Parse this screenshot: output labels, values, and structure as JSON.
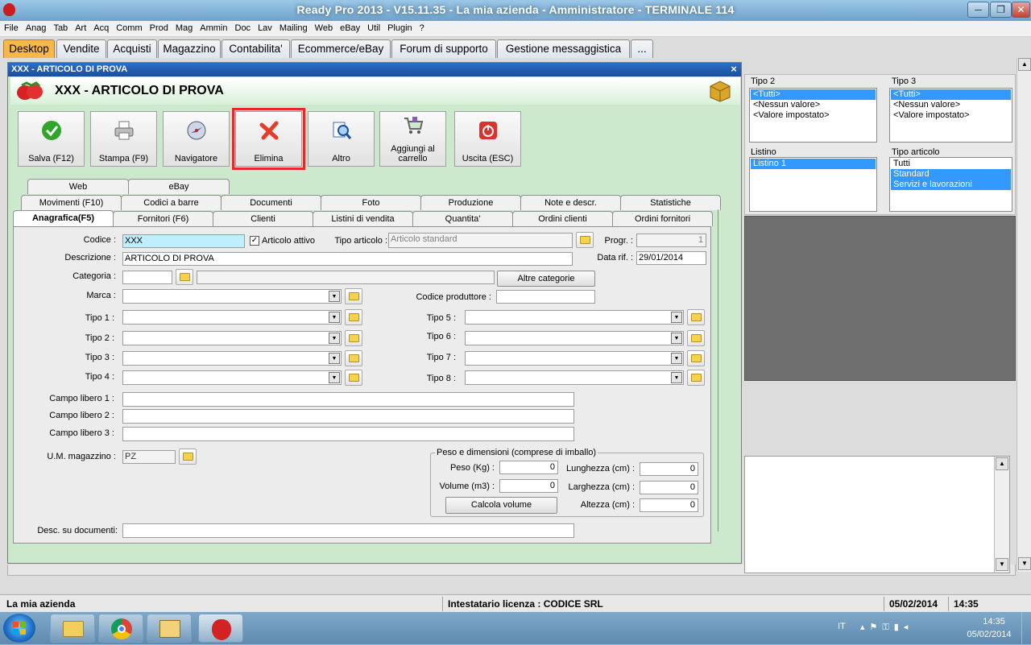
{
  "window": {
    "title": "Ready Pro 2013 - V15.11.35 - La mia azienda - Amministratore - TERMINALE 114",
    "min": "─",
    "restore": "❐",
    "close": "✕"
  },
  "menu": [
    "File",
    "Anag",
    "Tab",
    "Art",
    "Acq",
    "Comm",
    "Prod",
    "Mag",
    "Ammin",
    "Doc",
    "Lav",
    "Mailing",
    "Web",
    "eBay",
    "Util",
    "Plugin",
    "?"
  ],
  "top_tabs": [
    "Desktop",
    "Vendite",
    "Acquisti",
    "Magazzino",
    "Contabilita'",
    "Ecommerce/eBay",
    "Forum di supporto",
    "Gestione messaggistica",
    "..."
  ],
  "right_filters": {
    "tipo2": {
      "label": "Tipo 2",
      "items": [
        "<Tutti>",
        "<Nessun valore>",
        "<Valore impostato>"
      ]
    },
    "tipo3": {
      "label": "Tipo 3",
      "items": [
        "<Tutti>",
        "<Nessun valore>",
        "<Valore impostato>"
      ]
    },
    "listino": {
      "label": "Listino",
      "items": [
        "Listino 1"
      ]
    },
    "tipo_articolo": {
      "label": "Tipo articolo",
      "items": [
        "Tutti",
        "Standard",
        "Servizi e lavorazioni"
      ]
    }
  },
  "dialog": {
    "title": "XXX - ARTICOLO DI PROVA",
    "header": "XXX - ARTICOLO DI PROVA",
    "close": "×",
    "toolbar": [
      "Salva (F12)",
      "Stampa (F9)",
      "Navigatore",
      "Elimina",
      "Altro",
      "Aggiungi al carrello",
      "Uscita (ESC)"
    ],
    "tabs_row1": [
      "Web",
      "eBay"
    ],
    "tabs_row2": [
      "Movimenti (F10)",
      "Codici a barre",
      "Documenti",
      "Foto",
      "Produzione",
      "Note e descr.",
      "Statistiche"
    ],
    "tabs_row3": [
      "Anagrafica(F5)",
      "Fornitori (F6)",
      "Clienti",
      "Listini di vendita",
      "Quantita'",
      "Ordini clienti",
      "Ordini fornitori"
    ],
    "form": {
      "codice_label": "Codice :",
      "codice": "XXX",
      "attivo_label": "Articolo attivo",
      "attivo_check": "✓",
      "tipo_art_label": "Tipo articolo :",
      "tipo_art": "Articolo standard",
      "progr_label": "Progr. :",
      "progr": "1",
      "descr_label": "Descrizione :",
      "descr": "ARTICOLO DI PROVA",
      "datarif_label": "Data rif. :",
      "datarif": "29/01/2014",
      "categoria_label": "Categoria :",
      "altre_cat": "Altre categorie",
      "marca_label": "Marca :",
      "codprod_label": "Codice produttore :",
      "tipo1": "Tipo 1 :",
      "tipo2": "Tipo 2 :",
      "tipo3": "Tipo 3 :",
      "tipo4": "Tipo 4 :",
      "tipo5": "Tipo 5 :",
      "tipo6": "Tipo 6 :",
      "tipo7": "Tipo 7 :",
      "tipo8": "Tipo 8 :",
      "cl1": "Campo libero 1 :",
      "cl2": "Campo libero 2 :",
      "cl3": "Campo libero 3 :",
      "um_label": "U.M. magazzino :",
      "um": "PZ",
      "peso_group": "Peso e dimensioni (comprese di imballo)",
      "peso_label": "Peso (Kg) :",
      "peso": "0",
      "volume_label": "Volume (m3) :",
      "volume": "0",
      "calcola": "Calcola volume",
      "lung_label": "Lunghezza (cm) :",
      "lung": "0",
      "larg_label": "Larghezza (cm) :",
      "larg": "0",
      "alt_label": "Altezza (cm) :",
      "alt": "0",
      "descdoc_label": "Desc. su documenti:"
    }
  },
  "statusbar": {
    "company": "La mia azienda",
    "license": "Intestatario licenza : CODICE SRL",
    "date": "05/02/2014",
    "time": "14:35"
  },
  "taskbar": {
    "lang": "IT",
    "time": "14:35",
    "date": "05/02/2014"
  },
  "colors": {
    "accent_tab": "#f6b84b",
    "delete_highlight": "#e8282b",
    "selection": "#3399ff",
    "dialog_bg": "#cde9cd"
  }
}
